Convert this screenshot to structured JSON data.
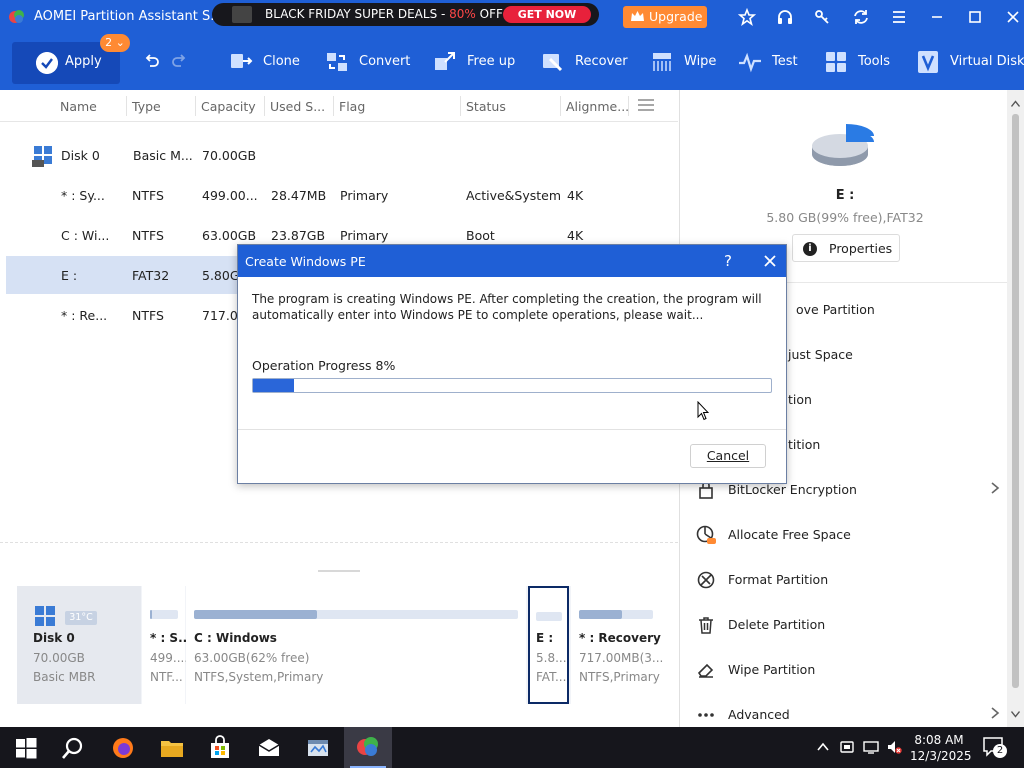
{
  "window": {
    "title": "AOMEI Partition Assistant S...",
    "promo": {
      "text_before": "BLACK FRIDAY SUPER DEALS - ",
      "text_red": "80%",
      "text_after": " OFF",
      "button": "GET NOW"
    },
    "upgrade_label": "Upgrade",
    "title_icons": [
      "star-icon",
      "headset-icon",
      "key-icon",
      "refresh-icon",
      "menu-icon",
      "minimize-icon",
      "maximize-icon",
      "close-icon"
    ]
  },
  "toolbar": {
    "apply_label": "Apply",
    "apply_badge": "2",
    "items": [
      {
        "label": "Clone",
        "icon": "clone-icon"
      },
      {
        "label": "Convert",
        "icon": "convert-icon"
      },
      {
        "label": "Free up",
        "icon": "free-up-icon"
      },
      {
        "label": "Recover",
        "icon": "recover-icon"
      },
      {
        "label": "Wipe",
        "icon": "wipe-icon"
      },
      {
        "label": "Test",
        "icon": "test-icon"
      },
      {
        "label": "Tools",
        "icon": "tools-icon"
      },
      {
        "label": "Virtual Disk",
        "icon": "virtual-disk-icon"
      }
    ]
  },
  "table": {
    "headers": [
      "Name",
      "Type",
      "Capacity",
      "Used S...",
      "Flag",
      "Status",
      "Alignme..."
    ],
    "rows": [
      {
        "name": "Disk 0",
        "type": "Basic M...",
        "capacity": "70.00GB",
        "used": "",
        "flag": "",
        "status": "",
        "align": "",
        "is_disk": true
      },
      {
        "name": "* : Sy...",
        "type": "NTFS",
        "capacity": "499.00...",
        "used": "28.47MB",
        "flag": "Primary",
        "status": "Active&System",
        "align": "4K"
      },
      {
        "name": "C : Wi...",
        "type": "NTFS",
        "capacity": "63.00GB",
        "used": "23.87GB",
        "flag": "Primary",
        "status": "Boot",
        "align": "4K"
      },
      {
        "name": "E :",
        "type": "FAT32",
        "capacity": "5.80G",
        "used": "",
        "flag": "",
        "status": "",
        "align": "",
        "selected": true
      },
      {
        "name": "* : Re...",
        "type": "NTFS",
        "capacity": "717.00",
        "used": "",
        "flag": "",
        "status": "",
        "align": ""
      }
    ]
  },
  "diskmap": {
    "disk": {
      "name": "Disk 0",
      "size": "70.00GB",
      "type": "Basic MBR",
      "temp": "31°C"
    },
    "partitions": [
      {
        "name": "* : S...",
        "l1": "499....",
        "l2": "NTF...",
        "fill": 0.06
      },
      {
        "name": "C : Windows",
        "l1": "63.00GB(62% free)",
        "l2": "NTFS,System,Primary",
        "fill": 0.38
      },
      {
        "name": "E :",
        "l1": "5.8...",
        "l2": "FAT...",
        "fill": 0.0,
        "selected": true
      },
      {
        "name": "* : Recovery",
        "l1": "717.00MB(3...",
        "l2": "NTFS,Primary",
        "fill": 0.58
      }
    ]
  },
  "right_panel": {
    "drive": "E :",
    "info": "5.80 GB(99% free),FAT32",
    "properties_label": "Properties",
    "operations": [
      {
        "label": "ove Partition",
        "icon": "move-icon"
      },
      {
        "label": "just Space",
        "icon": "adjust-icon"
      },
      {
        "label": "tion",
        "icon": "split-icon"
      },
      {
        "label": "tition",
        "icon": "merge-icon"
      },
      {
        "label": "BitLocker Encryption",
        "icon": "lock-icon",
        "submenu": true
      },
      {
        "label": "Allocate Free Space",
        "icon": "allocate-icon"
      },
      {
        "label": "Format Partition",
        "icon": "format-icon"
      },
      {
        "label": "Delete Partition",
        "icon": "trash-icon"
      },
      {
        "label": "Wipe Partition",
        "icon": "eraser-icon"
      },
      {
        "label": "Advanced",
        "icon": "more-icon",
        "submenu": true
      }
    ]
  },
  "dialog": {
    "title": "Create Windows PE",
    "help": "?",
    "message": "The program is creating Windows PE. After completing the creation, the program will automatically enter into Windows PE to complete operations, please wait...",
    "progress_label": "Operation Progress 8%",
    "progress": 0.08,
    "cancel_label": "Cancel"
  },
  "taskbar": {
    "time": "8:08 AM",
    "date": "12/3/2025",
    "notifications": "2"
  },
  "colors": {
    "accent": "#1f5fd6",
    "promo_red": "#ff4747",
    "upgrade": "#ff8a33",
    "progress": "#2a66d9"
  }
}
